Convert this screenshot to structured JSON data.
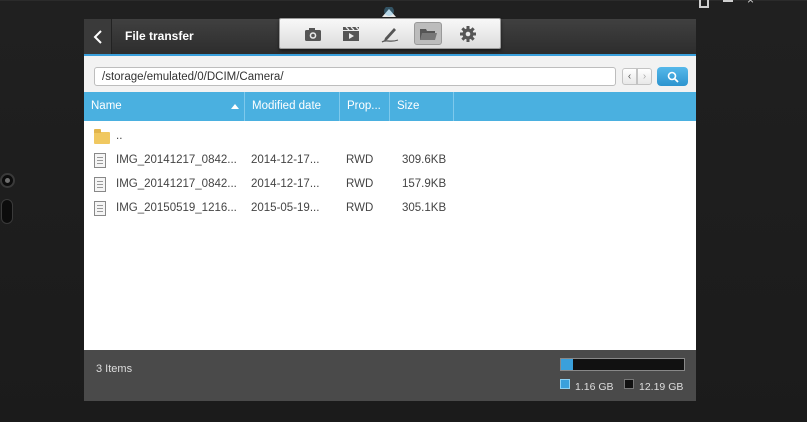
{
  "window": {
    "title": "File transfer",
    "controls": [
      "restore-icon",
      "minimize-icon",
      "close-icon"
    ]
  },
  "toolbar": {
    "tools": [
      {
        "name": "camera-icon",
        "active": false
      },
      {
        "name": "video-clapper-icon",
        "active": false
      },
      {
        "name": "pen-draw-icon",
        "active": false
      },
      {
        "name": "folder-open-icon",
        "active": true
      },
      {
        "name": "gear-icon",
        "active": false
      }
    ]
  },
  "path": {
    "value": "/storage/emulated/0/DCIM/Camera/",
    "prev_icon": "chevron-left-icon",
    "next_icon": "chevron-right-icon",
    "search_icon": "search-icon"
  },
  "columns": {
    "name": "Name",
    "modified": "Modified date",
    "prop": "Prop...",
    "size": "Size",
    "sort": "ascending"
  },
  "rows": [
    {
      "name": "..",
      "modified": "",
      "prop": "",
      "size": "",
      "icon": "folder-icon"
    },
    {
      "name": "IMG_20141217_0842...",
      "modified": "2014-12-17...",
      "prop": "RWD",
      "size": "309.6KB",
      "icon": "file-icon"
    },
    {
      "name": "IMG_20141217_0842...",
      "modified": "2014-12-17...",
      "prop": "RWD",
      "size": "157.9KB",
      "icon": "file-icon"
    },
    {
      "name": "IMG_20150519_1216...",
      "modified": "2015-05-19...",
      "prop": "RWD",
      "size": "305.1KB",
      "icon": "file-icon"
    }
  ],
  "status": {
    "item_count": "3 Items",
    "used": "1.16 GB",
    "total": "12.19 GB",
    "used_fraction": 0.095
  },
  "colors": {
    "accent": "#3aa0dc",
    "header": "#4ab0e0",
    "titlebar": "#333333",
    "statusbar": "#4a4a4a"
  }
}
